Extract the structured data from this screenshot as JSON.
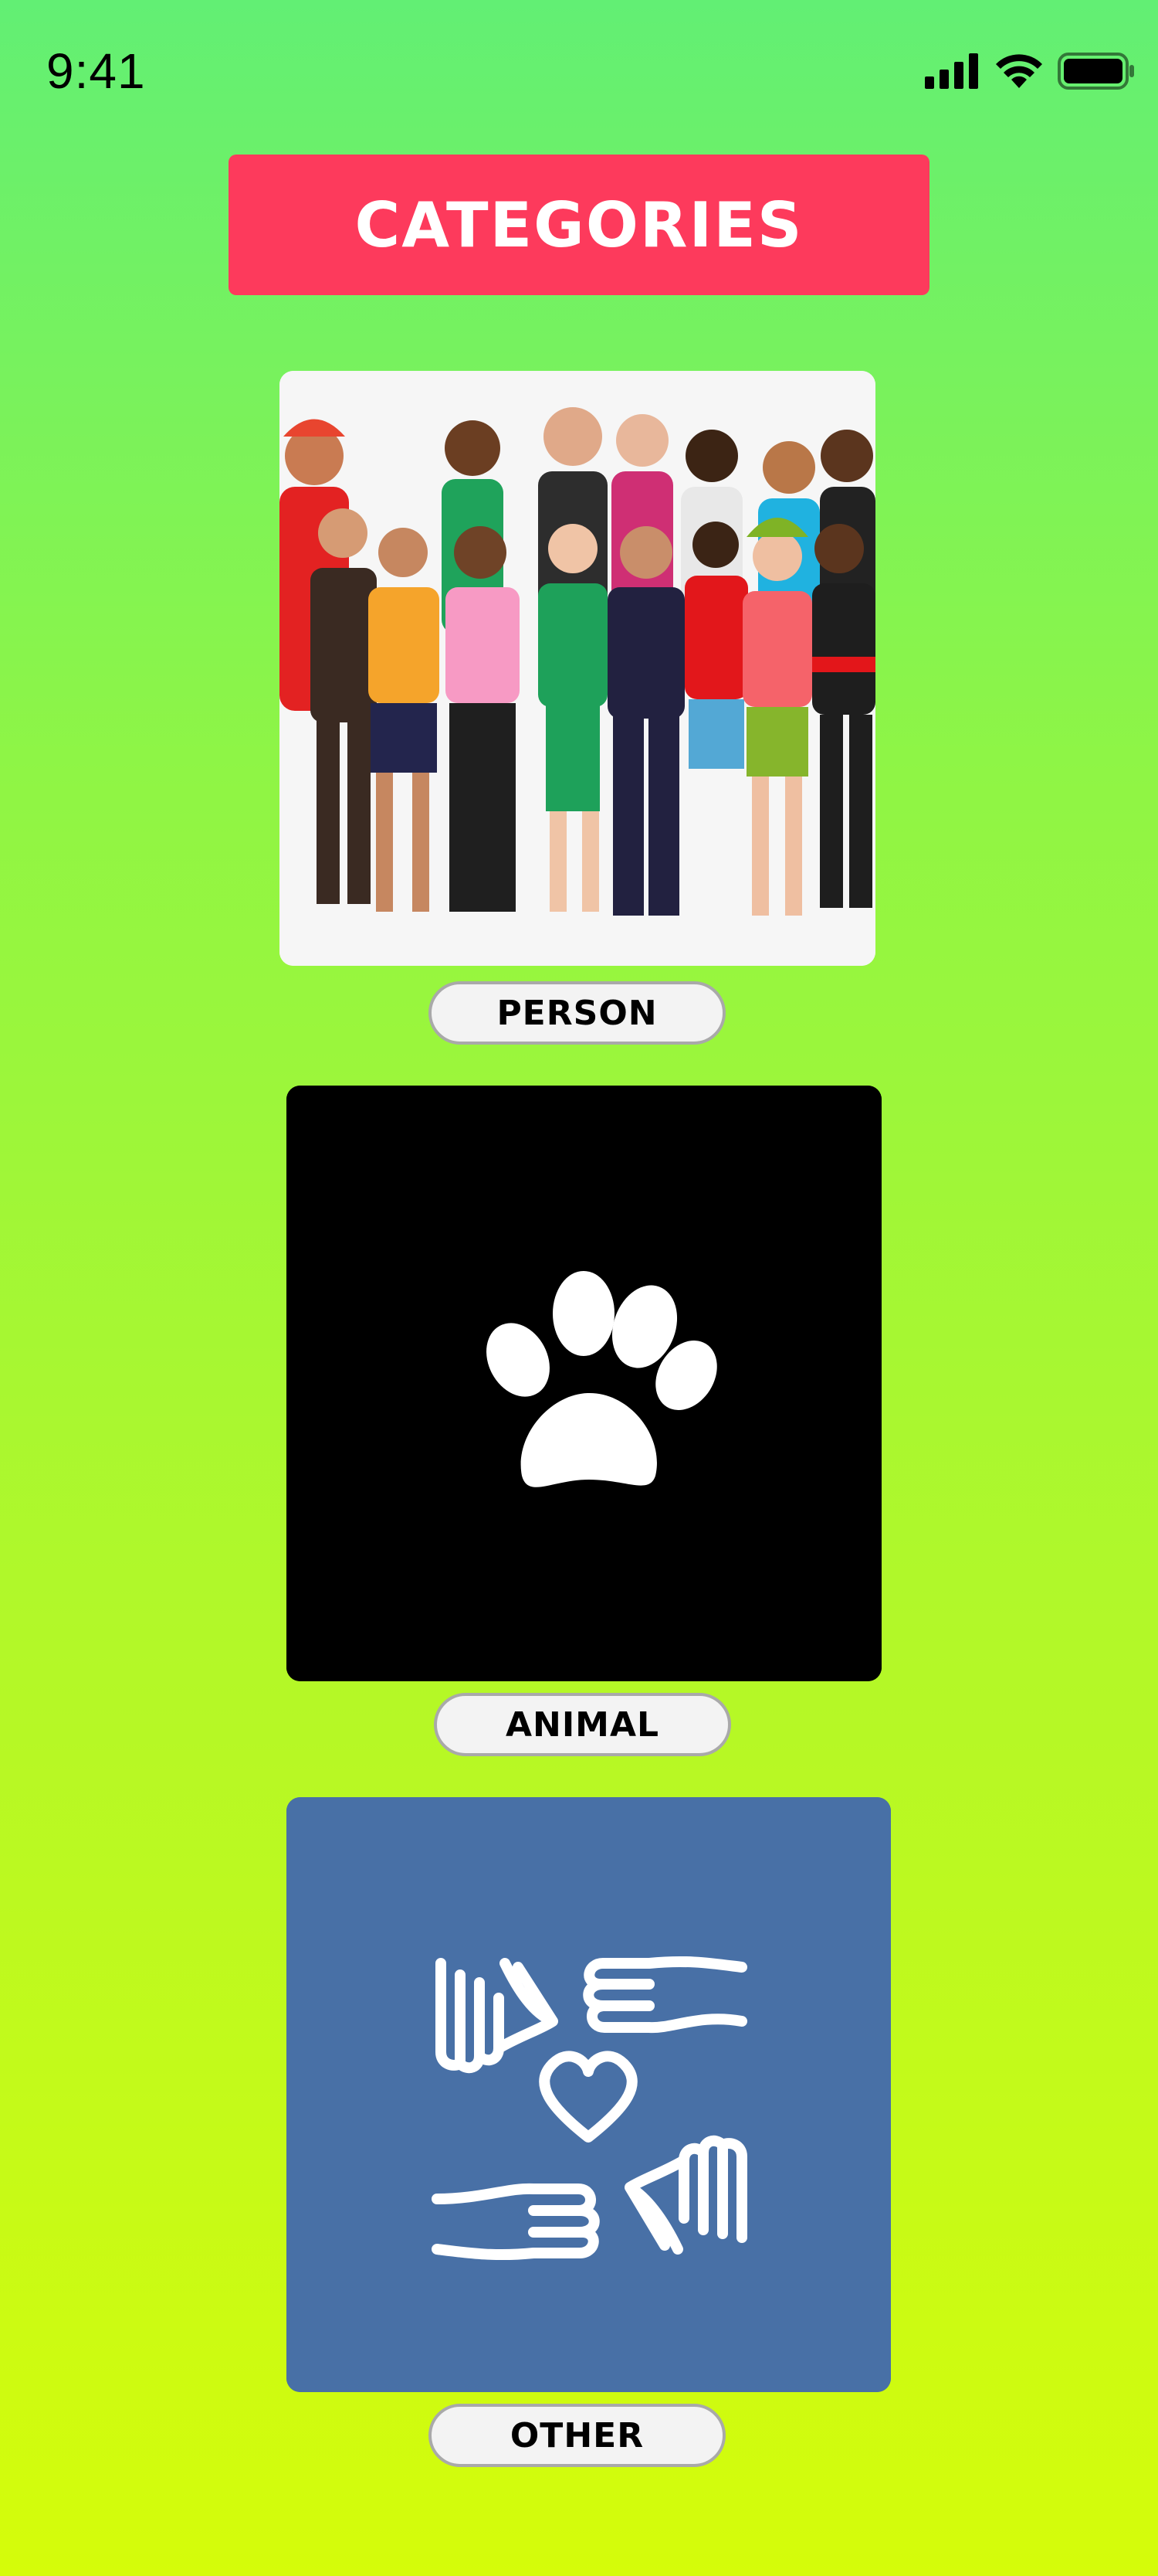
{
  "status_bar": {
    "time": "9:41",
    "icons": [
      "cellular-signal-icon",
      "wifi-icon",
      "battery-icon"
    ]
  },
  "header": {
    "title": "CATEGORIES",
    "color": "#fd3a5c"
  },
  "categories": [
    {
      "label": "PERSON",
      "image": "crowd-of-people-illustration"
    },
    {
      "label": "ANIMAL",
      "image": "paw-print-icon"
    },
    {
      "label": "OTHER",
      "image": "helping-hands-heart-icon"
    }
  ],
  "colors": {
    "background_top": "#62ef74",
    "background_bottom": "#d5fc0a",
    "animal_card": "#000000",
    "other_card": "#4870a6"
  }
}
